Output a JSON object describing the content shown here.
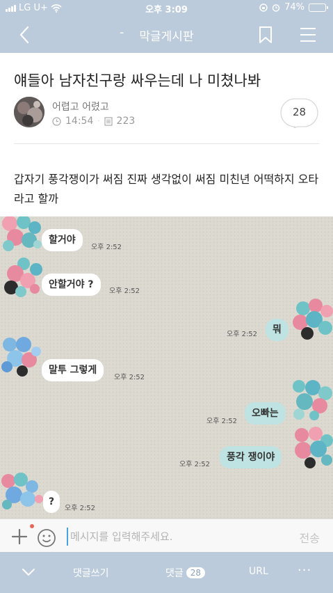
{
  "status_bar": {
    "carrier": "LG U+",
    "time": "오후 3:09",
    "battery": "74%",
    "battery_level": 0.74
  },
  "header": {
    "title": "막글게시판",
    "dash": "-",
    "icons": {
      "back": "back-chevron-icon",
      "bookmark": "bookmark-icon",
      "menu": "hamburger-menu-icon"
    }
  },
  "post": {
    "title": "얘들아 남자친구랑 싸우는데 나 미쳤나봐",
    "author": "어렵고 어렸고",
    "time": "14:54",
    "views": "223",
    "comment_count": "28",
    "body": "갑자기 풍각쟁이가 써짐 진짜 생각없이 써짐 미친년 어떡하지 오타라고 할까"
  },
  "chat": {
    "messages": [
      {
        "side": "left",
        "text": "할거야",
        "time": "오후 2:52"
      },
      {
        "side": "left",
        "text": "안할거야 ?",
        "time": "오후 2:52"
      },
      {
        "side": "right",
        "text": "뭐",
        "time": "오후 2:52"
      },
      {
        "side": "left",
        "text": "말투 그렇게",
        "time": "오후 2:52"
      },
      {
        "side": "right",
        "text": "오빠는",
        "time": "오후 2:52"
      },
      {
        "side": "right",
        "text": "풍각 쟁이야",
        "time": "오후 2:52"
      },
      {
        "side": "left",
        "text": "?",
        "time": "오후 2:52"
      }
    ]
  },
  "input_bar": {
    "placeholder": "메시지를 입력해주세요.",
    "send_label": "전송"
  },
  "bottom_bar": {
    "write_comment": "댓글쓰기",
    "comments_label": "댓글",
    "comments_count": "28",
    "url_label": "URL",
    "more_label": "···"
  },
  "colors": {
    "header_bg": "#bccbdc",
    "chat_bg": "#dcd9d1",
    "my_bubble": "#bfe3e2"
  }
}
